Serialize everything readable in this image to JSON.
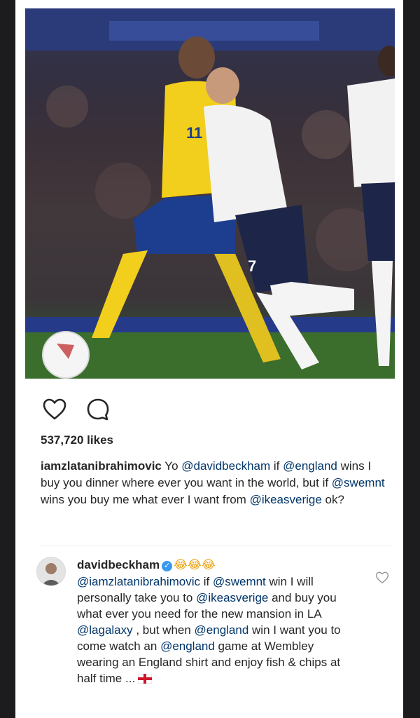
{
  "post": {
    "image_alt": "Two footballers contesting the ball, one in a yellow Sweden kit numbered 11, one in a white England kit",
    "actions": {
      "like_icon": "heart-outline-icon",
      "comment_icon": "comment-bubble-icon"
    },
    "likes_text": "537,720 likes",
    "caption": {
      "username": "iamzlatanibrahimovic",
      "t1": " Yo ",
      "m1": "@davidbeckham",
      "t2": " if ",
      "m2": "@england",
      "t3": " wins I buy you dinner where ever you want in the world, but if ",
      "m3": "@swemnt",
      "t4": " wins you buy me what ever I want from ",
      "m4": "@ikeasverige",
      "t5": " ok?"
    },
    "comment": {
      "username": "davidbeckham",
      "verified": true,
      "emojis": "😂😂😂",
      "m1": "@iamzlatanibrahimovic",
      "t1": " if ",
      "m2": "@swemnt",
      "t2": " win I will personally take you to ",
      "m3": "@ikeasverige",
      "t3": " and buy you what ever you need for the new mansion in LA ",
      "m4": "@lagalaxy",
      "t4": " , but when ",
      "m5": "@england",
      "t5": " win I want you to come watch an ",
      "m6": "@england",
      "t6": " game at Wembley wearing an England shirt and enjoy fish & chips at half time ...",
      "flag": "england-flag-icon"
    }
  },
  "colors": {
    "mention": "#003569",
    "verified": "#3897f0",
    "text": "#262626"
  }
}
